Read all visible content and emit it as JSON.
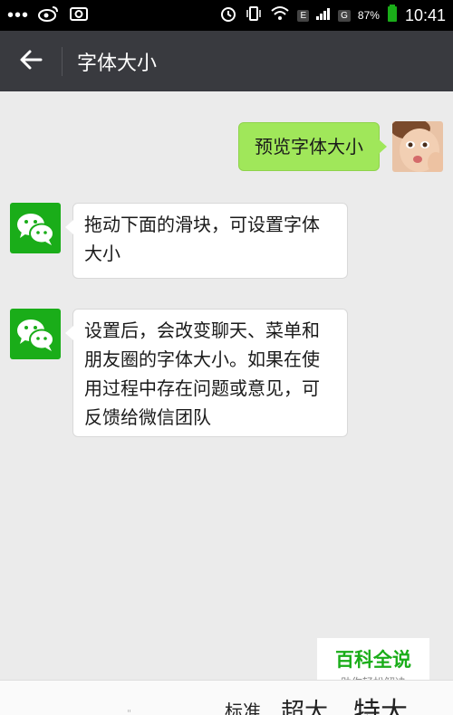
{
  "status_bar": {
    "dots": "•••",
    "network_e": "E",
    "network_g": "G",
    "battery": "87%",
    "time": "10:41"
  },
  "title_bar": {
    "title": "字体大小"
  },
  "messages": [
    {
      "side": "right",
      "text": "预览字体大小"
    },
    {
      "side": "left",
      "text": "拖动下面的滑块，可设置字体大小"
    },
    {
      "side": "left",
      "text": "设置后，会改变聊天、菜单和朋友圈的字体大小。如果在使用过程中存在问题或意见，可反馈给微信团队"
    }
  ],
  "watermark": {
    "main": "百科全说",
    "sub": "助你轻松解决"
  },
  "bottom_panel": {
    "labels": [
      "标准",
      "超大",
      "特大"
    ],
    "faint": "\""
  },
  "colors": {
    "title_bar": "#393a3f",
    "chat_bg": "#ebebeb",
    "sent_bubble": "#a0e75a",
    "wechat_green": "#1aad19"
  }
}
